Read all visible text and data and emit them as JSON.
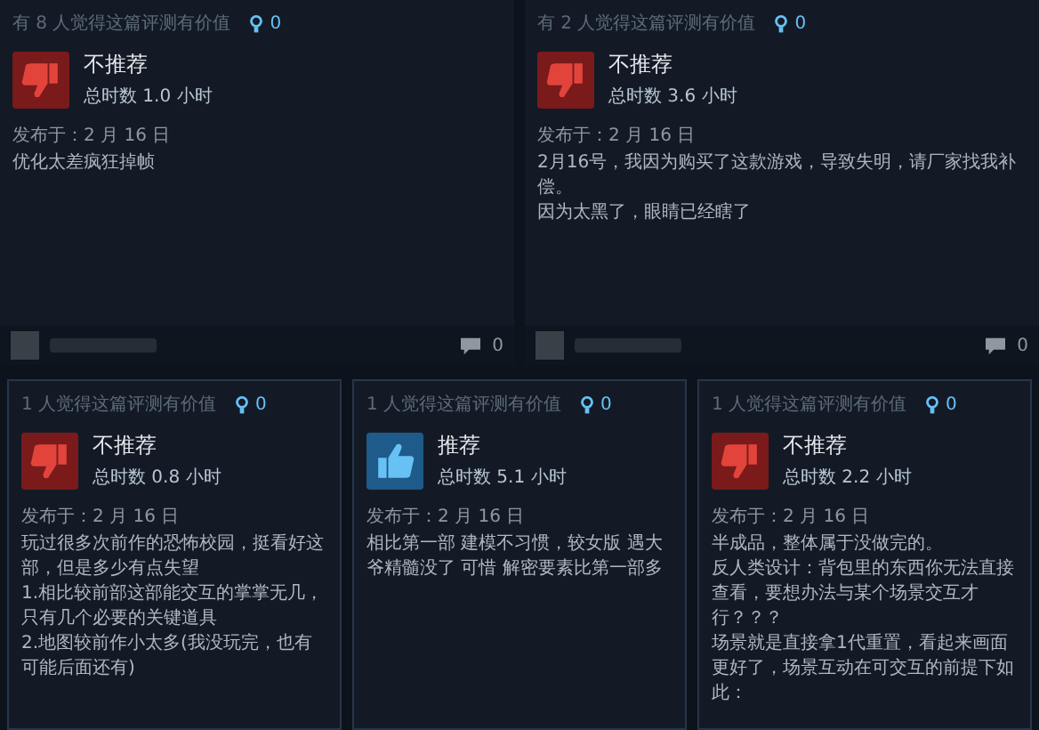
{
  "reviews": [
    {
      "helpful": "有 8 人觉得这篇评测有价值",
      "awards": "0",
      "recommended": false,
      "verdict": "不推荐",
      "hours": "总时数 1.0 小时",
      "posted": "发布于：2 月 16 日",
      "body": [
        "优化太差疯狂掉帧"
      ],
      "comments": "0"
    },
    {
      "helpful": "有 2 人觉得这篇评测有价值",
      "awards": "0",
      "recommended": false,
      "verdict": "不推荐",
      "hours": "总时数 3.6 小时",
      "posted": "发布于：2 月 16 日",
      "body": [
        "2月16号，我因为购买了这款游戏，导致失明，请厂家找我补偿。",
        "因为太黑了，眼睛已经瞎了"
      ],
      "comments": "0"
    },
    {
      "helpful": "1 人觉得这篇评测有价值",
      "awards": "0",
      "recommended": false,
      "verdict": "不推荐",
      "hours": "总时数 0.8 小时",
      "posted": "发布于：2 月 16 日",
      "body": [
        "玩过很多次前作的恐怖校园，挺看好这部，但是多少有点失望",
        "1.相比较前部这部能交互的掌掌无几，只有几个必要的关键道具",
        "2.地图较前作小太多(我没玩完，也有可能后面还有)"
      ]
    },
    {
      "helpful": "1 人觉得这篇评测有价值",
      "awards": "0",
      "recommended": true,
      "verdict": "推荐",
      "hours": "总时数 5.1 小时",
      "posted": "发布于：2 月 16 日",
      "body": [
        "相比第一部 建模不习惯，较女版 遇大爷精髓没了 可惜 解密要素比第一部多"
      ]
    },
    {
      "helpful": "1 人觉得这篇评测有价值",
      "awards": "0",
      "recommended": false,
      "verdict": "不推荐",
      "hours": "总时数 2.2 小时",
      "posted": "发布于：2 月 16 日",
      "body": [
        "半成品，整体属于没做完的。",
        "反人类设计：背包里的东西你无法直接查看，要想办法与某个场景交互才行？？？",
        "场景就是直接拿1代重置，看起来画面更好了，场景互动在可交互的前提下如此："
      ]
    }
  ]
}
